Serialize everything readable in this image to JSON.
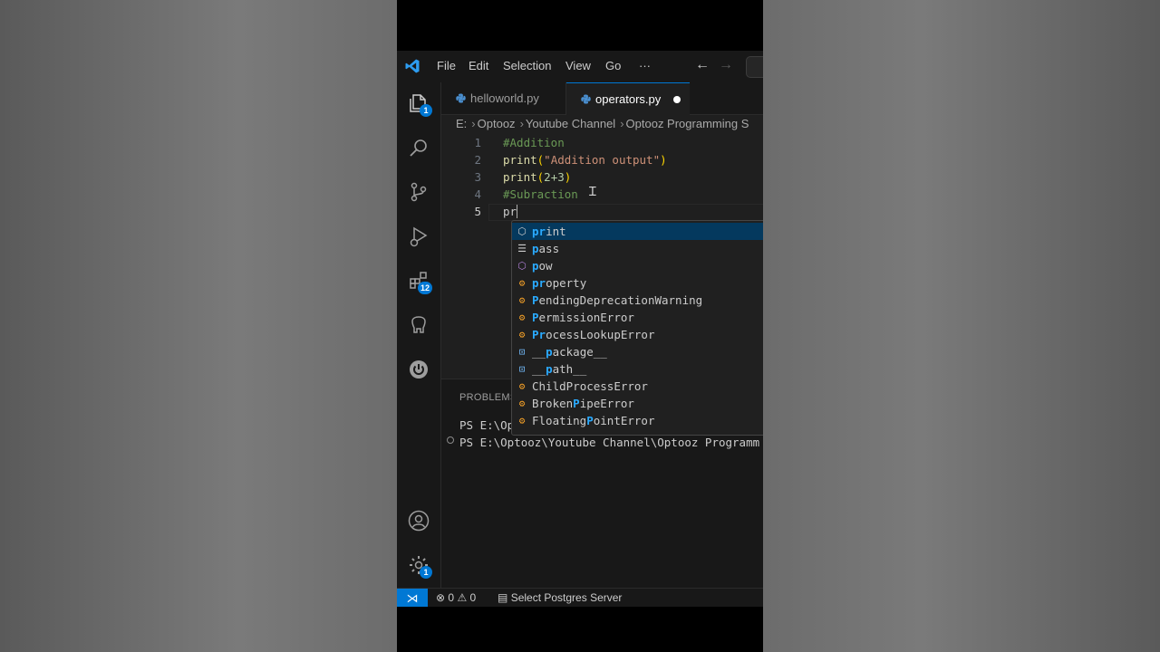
{
  "menu": {
    "file": "File",
    "edit": "Edit",
    "selection": "Selection",
    "view": "View",
    "go": "Go",
    "more": "···"
  },
  "nav": {
    "back": "←",
    "forward": "→"
  },
  "activity": {
    "explorer_badge": "1",
    "extensions_badge": "12",
    "settings_badge": "1"
  },
  "tabs": [
    {
      "label": "helloworld.py",
      "active": false
    },
    {
      "label": "operators.py",
      "active": true,
      "modified": true
    }
  ],
  "breadcrumb": [
    "E:",
    "Optooz",
    "Youtube Channel",
    "Optooz Programming S"
  ],
  "editor": {
    "lines": [
      {
        "number": "1",
        "text": "#Addition"
      },
      {
        "number": "2",
        "fn": "print",
        "open": "(",
        "str": "\"Addition output\"",
        "close": ")"
      },
      {
        "number": "3",
        "fn": "print",
        "open": "(",
        "num": "2+3",
        "close": ")"
      },
      {
        "number": "4",
        "text": "#Subraction"
      },
      {
        "number": "5",
        "text": "pr"
      }
    ]
  },
  "suggestions": [
    {
      "hl": "pr",
      "rest": "int",
      "kind": "method"
    },
    {
      "pre": "",
      "hl": "p",
      "rest": "ass",
      "kind": "keyword"
    },
    {
      "pre": "",
      "hl": "p",
      "rest": "ow",
      "kind": "method"
    },
    {
      "pre": "",
      "hl": "pr",
      "rest": "operty",
      "kind": "class"
    },
    {
      "pre": "",
      "hl": "P",
      "rest": "endingDeprecationWarning",
      "kind": "class"
    },
    {
      "pre": "",
      "hl": "P",
      "rest": "ermissionError",
      "kind": "class"
    },
    {
      "pre": "",
      "hl": "Pr",
      "rest": "ocessLookupError",
      "kind": "class"
    },
    {
      "pre": "__",
      "hl": "p",
      "rest": "ackage__",
      "kind": "variable"
    },
    {
      "pre": "__",
      "hl": "p",
      "rest": "ath__",
      "kind": "variable"
    },
    {
      "pre": "ChildPr",
      "hl": "",
      "rest": "ocessError",
      "kind": "class"
    },
    {
      "pre": "Broken",
      "hl": "P",
      "rest": "ipeError",
      "kind": "class"
    },
    {
      "pre": "Floating",
      "hl": "P",
      "rest": "ointError",
      "kind": "class"
    }
  ],
  "panel": {
    "title": "PROBLEMS",
    "terminal_line1": "PS E:\\Op",
    "terminal_line2": "PS E:\\Optooz\\Youtube Channel\\Optooz Programm"
  },
  "status": {
    "errors": "0",
    "warnings": "0",
    "postgres": "Select Postgres Server"
  },
  "colors": {
    "accent": "#0078d4",
    "editor_bg": "#1f1f1f",
    "sidebar_bg": "#181818"
  }
}
